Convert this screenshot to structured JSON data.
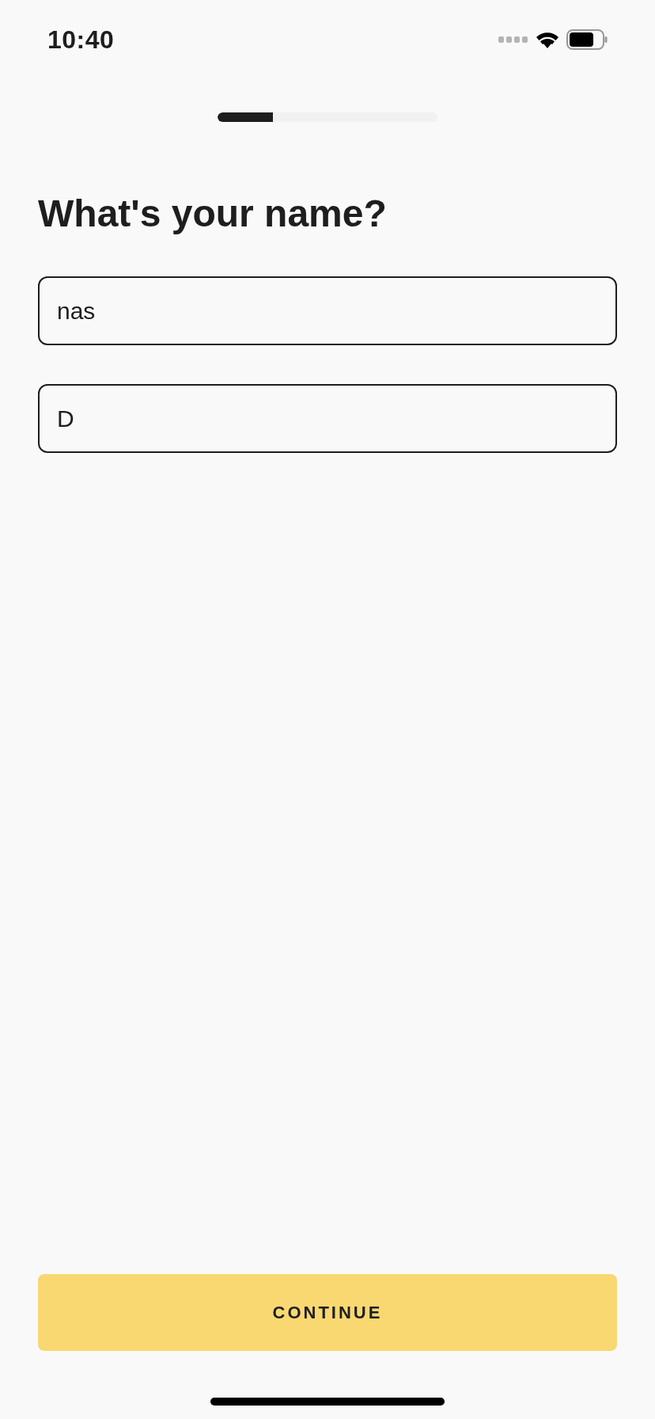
{
  "status_bar": {
    "time": "10:40"
  },
  "progress": {
    "level": 0.25
  },
  "title": "What's your name?",
  "fields": [
    {
      "value": "nas"
    },
    {
      "value": "D"
    }
  ],
  "button": {
    "label": "CONTINUE"
  }
}
